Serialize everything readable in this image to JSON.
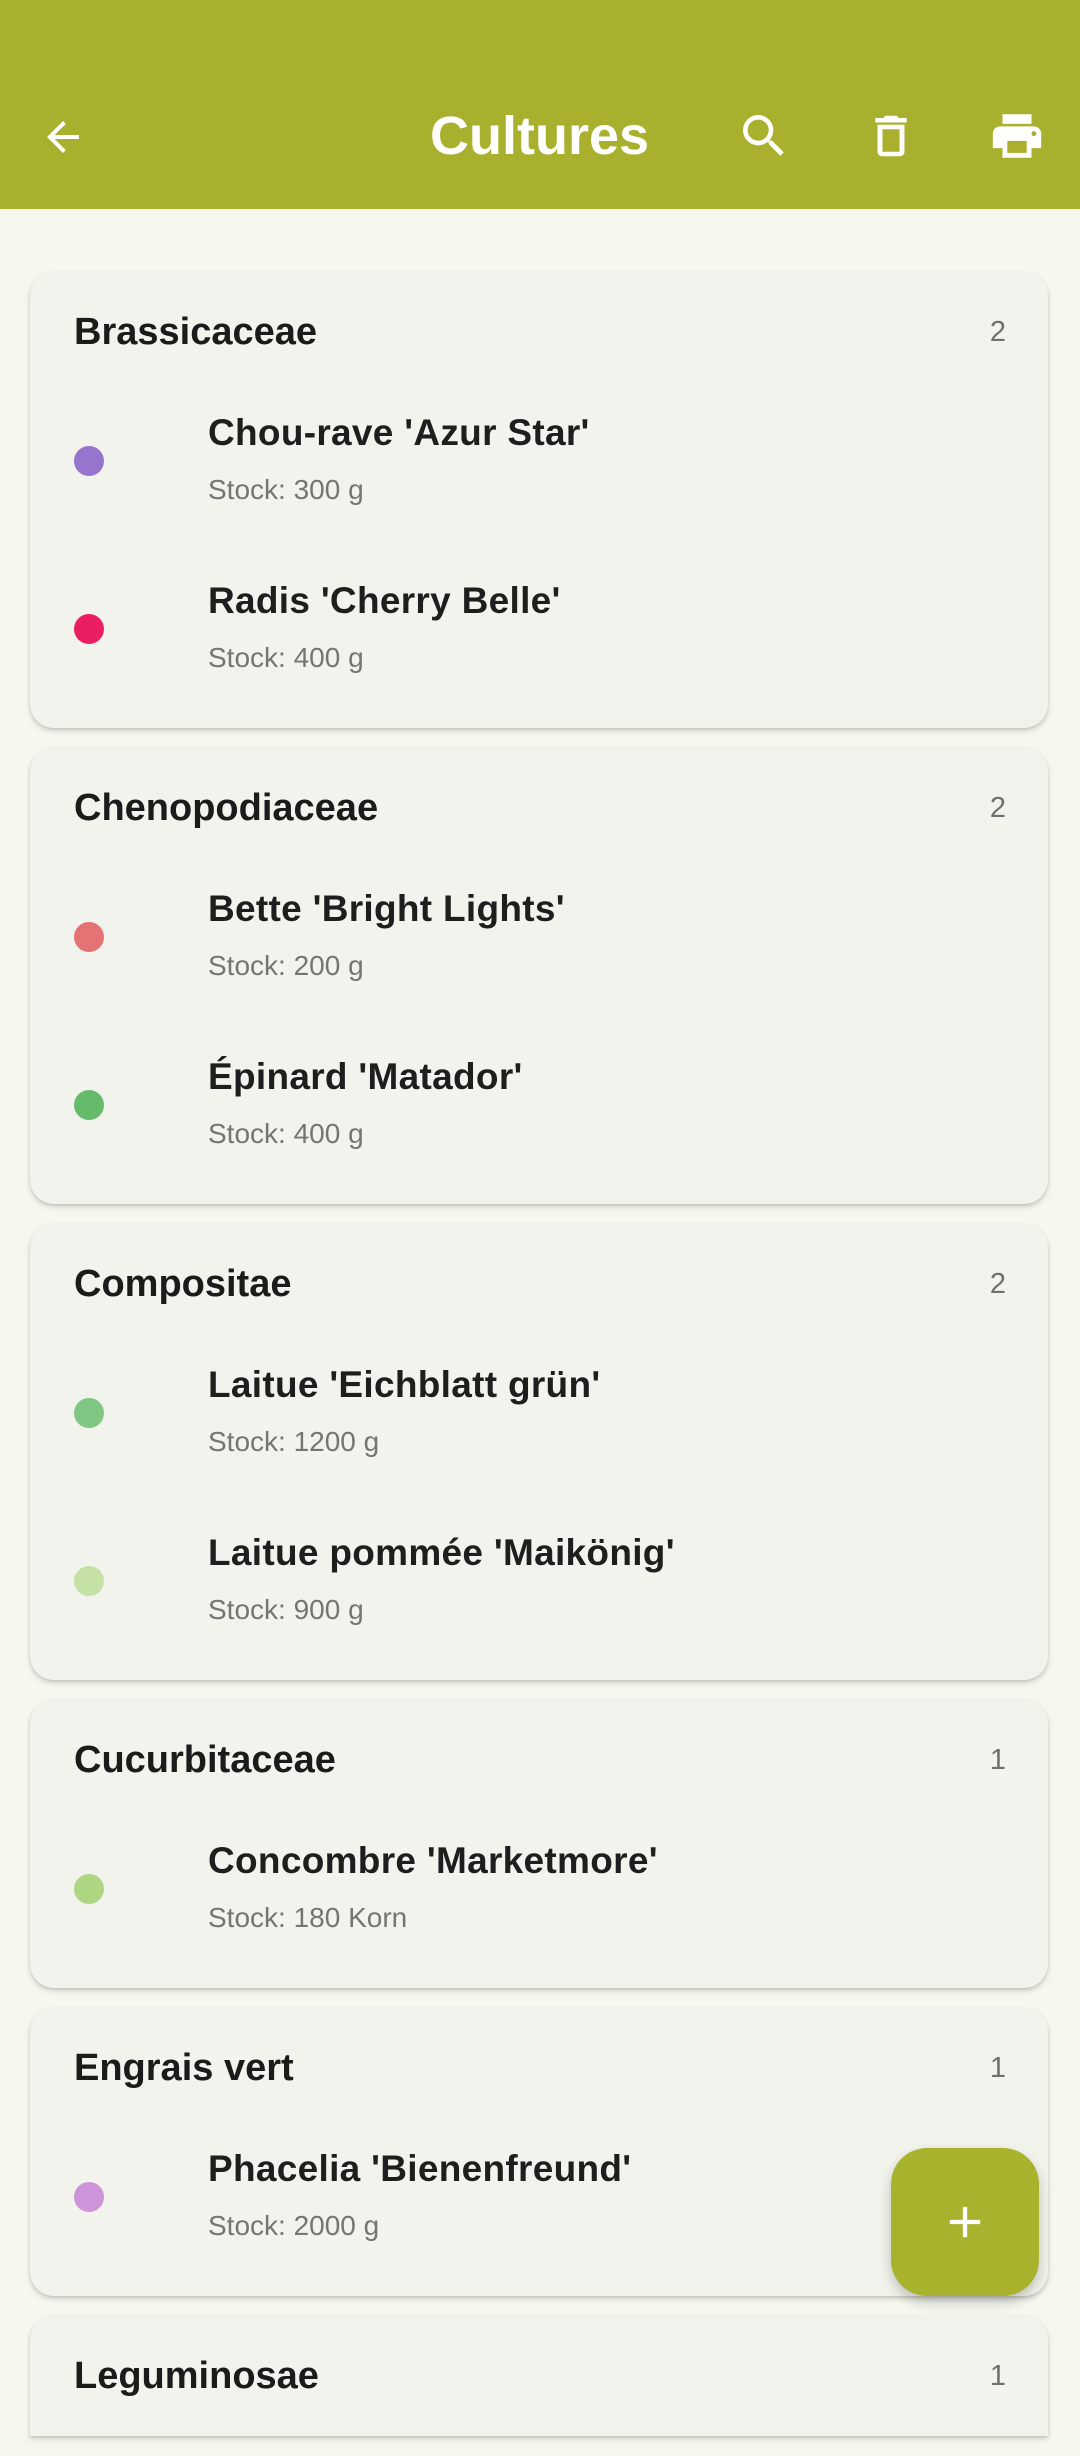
{
  "app_bar": {
    "title": "Cultures",
    "color": "#a8b02d",
    "icons": [
      "arrow-left-icon",
      "search-icon",
      "delete-icon",
      "print-icon"
    ]
  },
  "groups": [
    {
      "name": "Brassicaceae",
      "count": "2",
      "items": [
        {
          "name": "Chou-rave 'Azur Star'",
          "stock": "Stock: 300 g",
          "color": "#9575cd"
        },
        {
          "name": "Radis 'Cherry Belle'",
          "stock": "Stock: 400 g",
          "color": "#e91e63"
        }
      ]
    },
    {
      "name": "Chenopodiaceae",
      "count": "2",
      "items": [
        {
          "name": "Bette 'Bright Lights'",
          "stock": "Stock: 200 g",
          "color": "#e57373"
        },
        {
          "name": "Épinard 'Matador'",
          "stock": "Stock: 400 g",
          "color": "#66bb6a"
        }
      ]
    },
    {
      "name": "Compositae",
      "count": "2",
      "items": [
        {
          "name": "Laitue 'Eichblatt grün'",
          "stock": "Stock: 1200 g",
          "color": "#81c784"
        },
        {
          "name": "Laitue pommée 'Maikönig'",
          "stock": "Stock: 900 g",
          "color": "#c5e1a5"
        }
      ]
    },
    {
      "name": "Cucurbitaceae",
      "count": "1",
      "items": [
        {
          "name": "Concombre 'Marketmore'",
          "stock": "Stock: 180 Korn",
          "color": "#aed581"
        }
      ]
    },
    {
      "name": "Engrais vert",
      "count": "1",
      "items": [
        {
          "name": "Phacelia 'Bienenfreund'",
          "stock": "Stock: 2000 g",
          "color": "#ce93d8"
        }
      ]
    },
    {
      "name": "Leguminosae",
      "count": "1",
      "items": []
    }
  ],
  "fab": {
    "icon": "plus-icon",
    "color": "#a9b22c"
  }
}
